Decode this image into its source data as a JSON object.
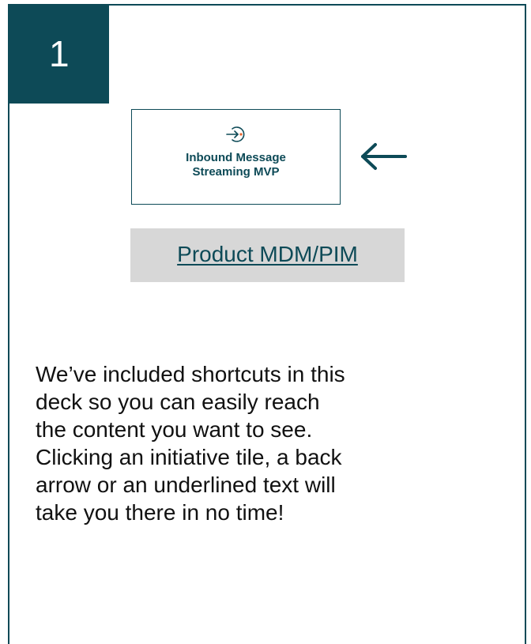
{
  "step": {
    "number": "1"
  },
  "tile": {
    "icon": "login-arrow-icon",
    "label_line1": "Inbound Message",
    "label_line2": "Streaming MVP"
  },
  "back_arrow": {
    "icon": "arrow-left-icon"
  },
  "link": {
    "text": "Product MDM/PIM"
  },
  "instructions": {
    "line1": "We’ve included shortcuts in this",
    "line2": "deck so you can easily reach",
    "line3": "the content you want to see.",
    "line4": "Clicking an initiative tile, a back",
    "line5": "arrow or an underlined text will",
    "line6": "take you there in no time!"
  },
  "colors": {
    "primary": "#0d4a57",
    "accent": "#e8632c",
    "chip_bg": "#d7d7d7",
    "text": "#111111"
  }
}
